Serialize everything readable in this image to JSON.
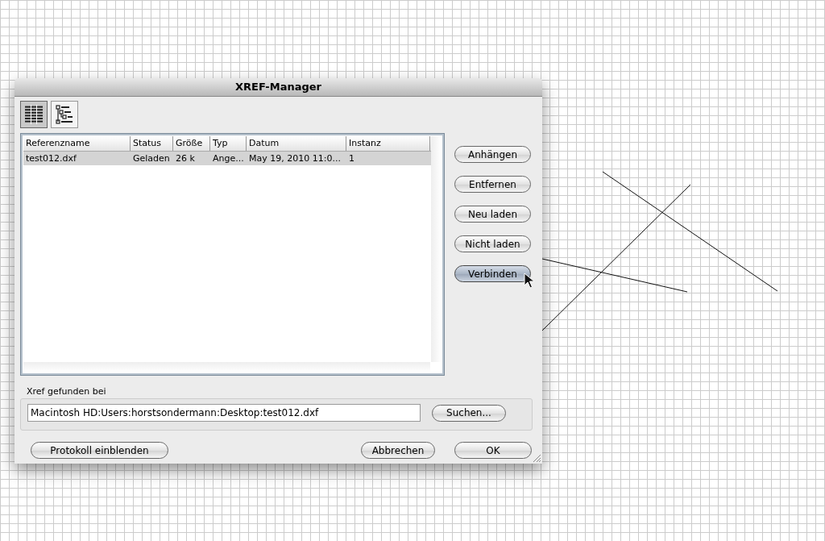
{
  "window": {
    "title": "XREF-Manager"
  },
  "view_toggles": [
    {
      "kind": "list",
      "selected": true
    },
    {
      "kind": "tree",
      "selected": false
    }
  ],
  "table": {
    "columns": [
      "Referenzname",
      "Status",
      "Größe",
      "Typ",
      "Datum",
      "Instanz"
    ],
    "rows": [
      {
        "cells": [
          "test012.dxf",
          "Geladen",
          "26 k",
          "Ange...",
          "May 19, 2010 11:0...",
          "1"
        ],
        "selected": true
      }
    ]
  },
  "side_buttons": [
    {
      "label": "Anhängen",
      "selected": false
    },
    {
      "label": "Entfernen",
      "selected": false
    },
    {
      "label": "Neu laden",
      "selected": false
    },
    {
      "label": "Nicht laden",
      "selected": false
    },
    {
      "label": "Verbinden",
      "selected": true
    }
  ],
  "found_at": {
    "label": "Xref gefunden bei",
    "value": "Macintosh HD:Users:horstsondermann:Desktop:test012.dxf",
    "button": "Suchen..."
  },
  "footer": {
    "log_button": "Protokoll einblenden",
    "cancel_button": "Abbrechen",
    "ok_button": "OK"
  }
}
